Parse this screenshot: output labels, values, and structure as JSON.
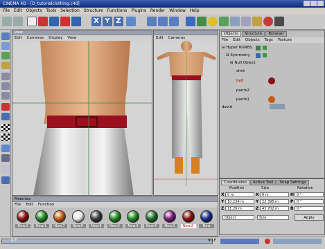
{
  "window": {
    "title": "CINEMA 4D - [D_tutorialclothing.c4d]"
  },
  "menu": [
    "File",
    "Edit",
    "Objects",
    "Tools",
    "Selection",
    "Structure",
    "Functions",
    "Plugins",
    "Render",
    "Window",
    "Help"
  ],
  "viewport_front": {
    "panel_label": "View",
    "menu": [
      "Edit",
      "Cameras",
      "Display",
      "View"
    ]
  },
  "viewport_back": {
    "menu": [
      "Edit",
      "Cameras"
    ]
  },
  "object_manager": {
    "tabs": [
      "Objects",
      "Structure",
      "Browser"
    ],
    "menu": [
      "File",
      "Edit",
      "Objects",
      "Tags",
      "Texture"
    ],
    "items": [
      "Hyper NURBS",
      "Symmetry",
      "Null Object",
      "shirt",
      "belt",
      "pants2",
      "pants1",
      "david"
    ]
  },
  "attributes": {
    "tabs": [
      "Coordinates",
      "Active Tool",
      "Snap Settings"
    ],
    "headers": [
      "Position",
      "Size",
      "Rotation"
    ],
    "rows": [
      {
        "axis1": "X",
        "pos": "0 m",
        "axis2": "X",
        "size": "0 m",
        "axis3": "H",
        "rot": "0 °"
      },
      {
        "axis1": "Y",
        "pos": "10.234 m",
        "axis2": "Y",
        "size": "22.395 m",
        "axis3": "P",
        "rot": "0 °"
      },
      {
        "axis1": "Z",
        "pos": "11.29 m",
        "axis2": "Z",
        "size": "43.702 m",
        "axis3": "B",
        "rot": "0 °"
      }
    ],
    "mode1": "Object",
    "mode2": "Size",
    "apply_label": "Apply"
  },
  "materials": {
    "panel_label": "Materials",
    "menu": [
      "File",
      "Edit",
      "Function"
    ],
    "items": [
      {
        "name": "New.2",
        "color": "#8a1010",
        "selected": false
      },
      {
        "name": "New.1",
        "color": "#1e8a1e",
        "selected": false
      },
      {
        "name": "New.7",
        "color": "#c85a10",
        "selected": false
      },
      {
        "name": "New.8",
        "color": "#e8e8e8",
        "selected": false
      },
      {
        "name": "New.6",
        "color": "#3a3a3a",
        "selected": false
      },
      {
        "name": "New.5",
        "color": "#1e8a1e",
        "selected": false
      },
      {
        "name": "New.3",
        "color": "#1e8a1e",
        "selected": false
      },
      {
        "name": "New.4",
        "color": "#1e6a2a",
        "selected": false
      },
      {
        "name": "New.1",
        "color": "#7a1a7a",
        "selected": false
      },
      {
        "name": "New.2",
        "color": "#8a1010",
        "selected": true
      },
      {
        "name": "New",
        "color": "#1a2a8a",
        "selected": false
      }
    ]
  },
  "timeline": {
    "current_frame": "0 F",
    "end_frame": "90 F"
  }
}
